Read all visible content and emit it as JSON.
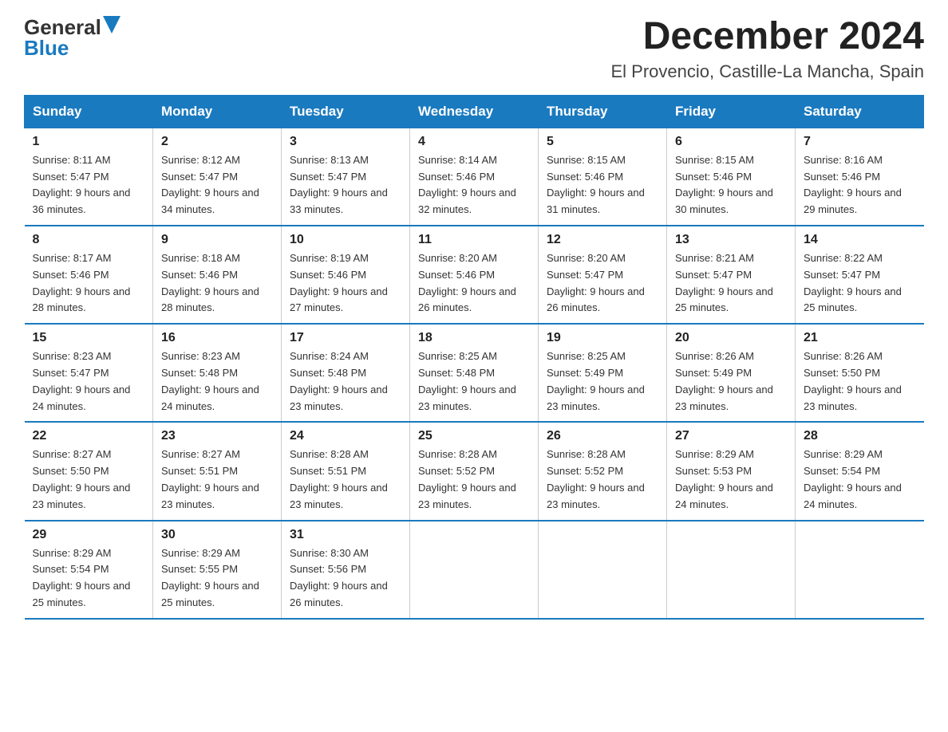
{
  "header": {
    "logo_general": "General",
    "logo_blue": "Blue",
    "month_title": "December 2024",
    "location": "El Provencio, Castille-La Mancha, Spain"
  },
  "days_of_week": [
    "Sunday",
    "Monday",
    "Tuesday",
    "Wednesday",
    "Thursday",
    "Friday",
    "Saturday"
  ],
  "weeks": [
    [
      {
        "day": "1",
        "sunrise": "8:11 AM",
        "sunset": "5:47 PM",
        "daylight": "9 hours and 36 minutes."
      },
      {
        "day": "2",
        "sunrise": "8:12 AM",
        "sunset": "5:47 PM",
        "daylight": "9 hours and 34 minutes."
      },
      {
        "day": "3",
        "sunrise": "8:13 AM",
        "sunset": "5:47 PM",
        "daylight": "9 hours and 33 minutes."
      },
      {
        "day": "4",
        "sunrise": "8:14 AM",
        "sunset": "5:46 PM",
        "daylight": "9 hours and 32 minutes."
      },
      {
        "day": "5",
        "sunrise": "8:15 AM",
        "sunset": "5:46 PM",
        "daylight": "9 hours and 31 minutes."
      },
      {
        "day": "6",
        "sunrise": "8:15 AM",
        "sunset": "5:46 PM",
        "daylight": "9 hours and 30 minutes."
      },
      {
        "day": "7",
        "sunrise": "8:16 AM",
        "sunset": "5:46 PM",
        "daylight": "9 hours and 29 minutes."
      }
    ],
    [
      {
        "day": "8",
        "sunrise": "8:17 AM",
        "sunset": "5:46 PM",
        "daylight": "9 hours and 28 minutes."
      },
      {
        "day": "9",
        "sunrise": "8:18 AM",
        "sunset": "5:46 PM",
        "daylight": "9 hours and 28 minutes."
      },
      {
        "day": "10",
        "sunrise": "8:19 AM",
        "sunset": "5:46 PM",
        "daylight": "9 hours and 27 minutes."
      },
      {
        "day": "11",
        "sunrise": "8:20 AM",
        "sunset": "5:46 PM",
        "daylight": "9 hours and 26 minutes."
      },
      {
        "day": "12",
        "sunrise": "8:20 AM",
        "sunset": "5:47 PM",
        "daylight": "9 hours and 26 minutes."
      },
      {
        "day": "13",
        "sunrise": "8:21 AM",
        "sunset": "5:47 PM",
        "daylight": "9 hours and 25 minutes."
      },
      {
        "day": "14",
        "sunrise": "8:22 AM",
        "sunset": "5:47 PM",
        "daylight": "9 hours and 25 minutes."
      }
    ],
    [
      {
        "day": "15",
        "sunrise": "8:23 AM",
        "sunset": "5:47 PM",
        "daylight": "9 hours and 24 minutes."
      },
      {
        "day": "16",
        "sunrise": "8:23 AM",
        "sunset": "5:48 PM",
        "daylight": "9 hours and 24 minutes."
      },
      {
        "day": "17",
        "sunrise": "8:24 AM",
        "sunset": "5:48 PM",
        "daylight": "9 hours and 23 minutes."
      },
      {
        "day": "18",
        "sunrise": "8:25 AM",
        "sunset": "5:48 PM",
        "daylight": "9 hours and 23 minutes."
      },
      {
        "day": "19",
        "sunrise": "8:25 AM",
        "sunset": "5:49 PM",
        "daylight": "9 hours and 23 minutes."
      },
      {
        "day": "20",
        "sunrise": "8:26 AM",
        "sunset": "5:49 PM",
        "daylight": "9 hours and 23 minutes."
      },
      {
        "day": "21",
        "sunrise": "8:26 AM",
        "sunset": "5:50 PM",
        "daylight": "9 hours and 23 minutes."
      }
    ],
    [
      {
        "day": "22",
        "sunrise": "8:27 AM",
        "sunset": "5:50 PM",
        "daylight": "9 hours and 23 minutes."
      },
      {
        "day": "23",
        "sunrise": "8:27 AM",
        "sunset": "5:51 PM",
        "daylight": "9 hours and 23 minutes."
      },
      {
        "day": "24",
        "sunrise": "8:28 AM",
        "sunset": "5:51 PM",
        "daylight": "9 hours and 23 minutes."
      },
      {
        "day": "25",
        "sunrise": "8:28 AM",
        "sunset": "5:52 PM",
        "daylight": "9 hours and 23 minutes."
      },
      {
        "day": "26",
        "sunrise": "8:28 AM",
        "sunset": "5:52 PM",
        "daylight": "9 hours and 23 minutes."
      },
      {
        "day": "27",
        "sunrise": "8:29 AM",
        "sunset": "5:53 PM",
        "daylight": "9 hours and 24 minutes."
      },
      {
        "day": "28",
        "sunrise": "8:29 AM",
        "sunset": "5:54 PM",
        "daylight": "9 hours and 24 minutes."
      }
    ],
    [
      {
        "day": "29",
        "sunrise": "8:29 AM",
        "sunset": "5:54 PM",
        "daylight": "9 hours and 25 minutes."
      },
      {
        "day": "30",
        "sunrise": "8:29 AM",
        "sunset": "5:55 PM",
        "daylight": "9 hours and 25 minutes."
      },
      {
        "day": "31",
        "sunrise": "8:30 AM",
        "sunset": "5:56 PM",
        "daylight": "9 hours and 26 minutes."
      },
      null,
      null,
      null,
      null
    ]
  ]
}
